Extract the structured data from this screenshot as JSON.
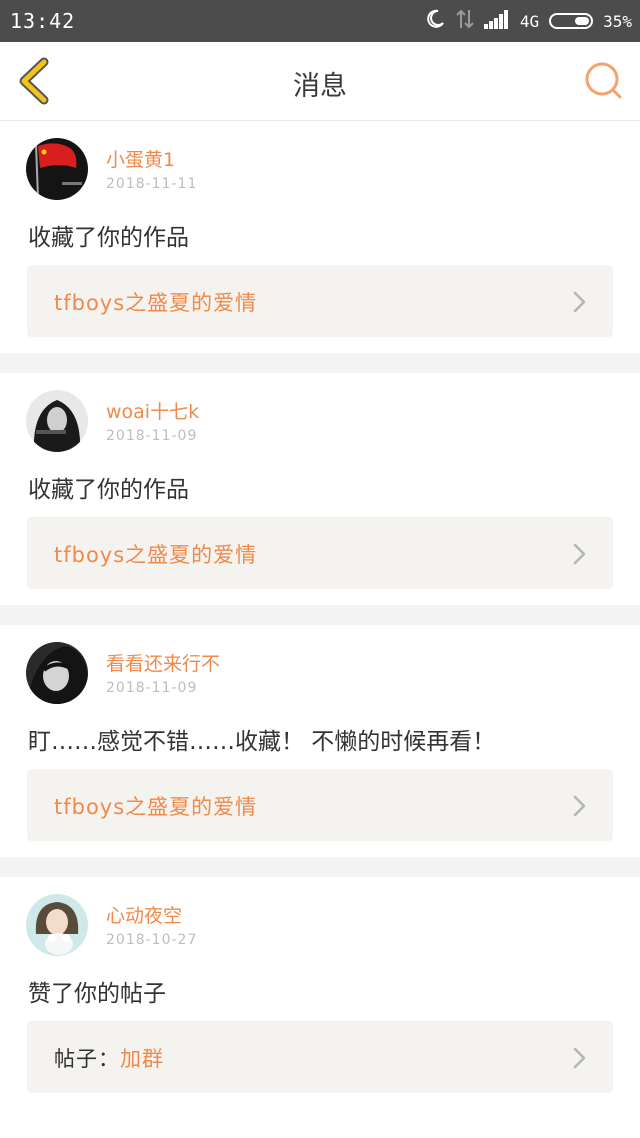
{
  "status_bar": {
    "time": "13:42",
    "network": "4G",
    "battery": "35%"
  },
  "header": {
    "title": "消息",
    "back_icon": "chevron-left-icon",
    "search_icon": "search-icon"
  },
  "colors": {
    "accent": "#f08a4b",
    "back_icon": "#f2c31a",
    "status_bar_bg": "#4c4c4c",
    "ref_box_bg": "#f4f3ef"
  },
  "messages": [
    {
      "username": "小蛋黄1",
      "date": "2018-11-11",
      "action": "收藏了你的作品",
      "reference": "tfboys之盛夏的爱情"
    },
    {
      "username": "woai十七k",
      "date": "2018-11-09",
      "action": "收藏了你的作品",
      "reference": "tfboys之盛夏的爱情"
    },
    {
      "username": "看看还来行不",
      "date": "2018-11-09",
      "action": "盯……感觉不错……收藏！ 不懒的时候再看！",
      "reference": "tfboys之盛夏的爱情"
    },
    {
      "username": "心动夜空",
      "date": "2018-10-27",
      "action": "赞了你的帖子",
      "reference_prefix": "帖子：",
      "reference": "加群"
    }
  ]
}
